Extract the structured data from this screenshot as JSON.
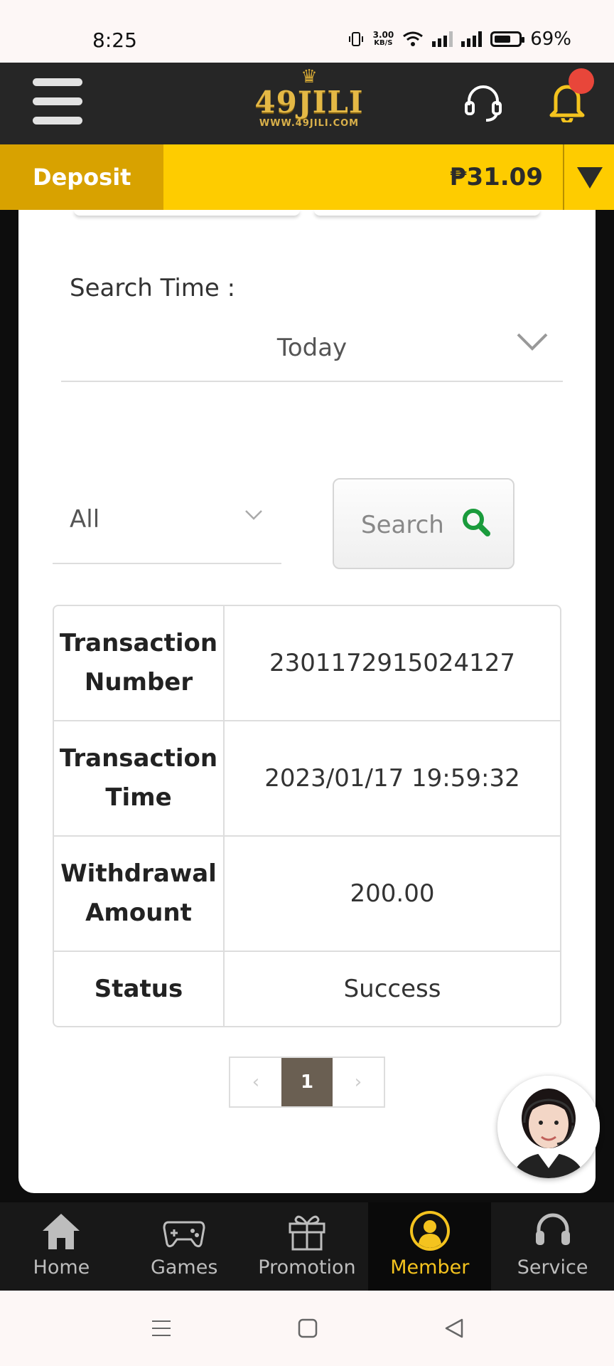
{
  "status_bar": {
    "time": "8:25",
    "net_speed_value": "3.00",
    "net_speed_unit": "KB/S",
    "battery": "69%"
  },
  "header": {
    "logo_text": "49JILI",
    "logo_url": "WWW.49JILI.COM"
  },
  "deposit_bar": {
    "deposit_label": "Deposit",
    "balance": "₱31.09"
  },
  "search": {
    "time_label": "Search Time :",
    "time_value": "Today",
    "type_value": "All",
    "button_label": "Search"
  },
  "transaction": {
    "number_label": "Transaction Number",
    "number_value": "2301172915024127",
    "time_label": "Transaction Time",
    "time_value": "2023/01/17 19:59:32",
    "amount_label": "Withdrawal Amount",
    "amount_value": "200.00",
    "status_label": "Status",
    "status_value": "Success"
  },
  "pagination": {
    "current": "1"
  },
  "bottom_nav": [
    {
      "label": "Home"
    },
    {
      "label": "Games"
    },
    {
      "label": "Promotion"
    },
    {
      "label": "Member"
    },
    {
      "label": "Service"
    }
  ],
  "colors": {
    "accent_yellow": "#fecc00",
    "deposit_dark": "#d8a200",
    "header_bg": "#262626",
    "search_icon_green": "#1a9b3c",
    "member_active": "#f4c31e"
  }
}
